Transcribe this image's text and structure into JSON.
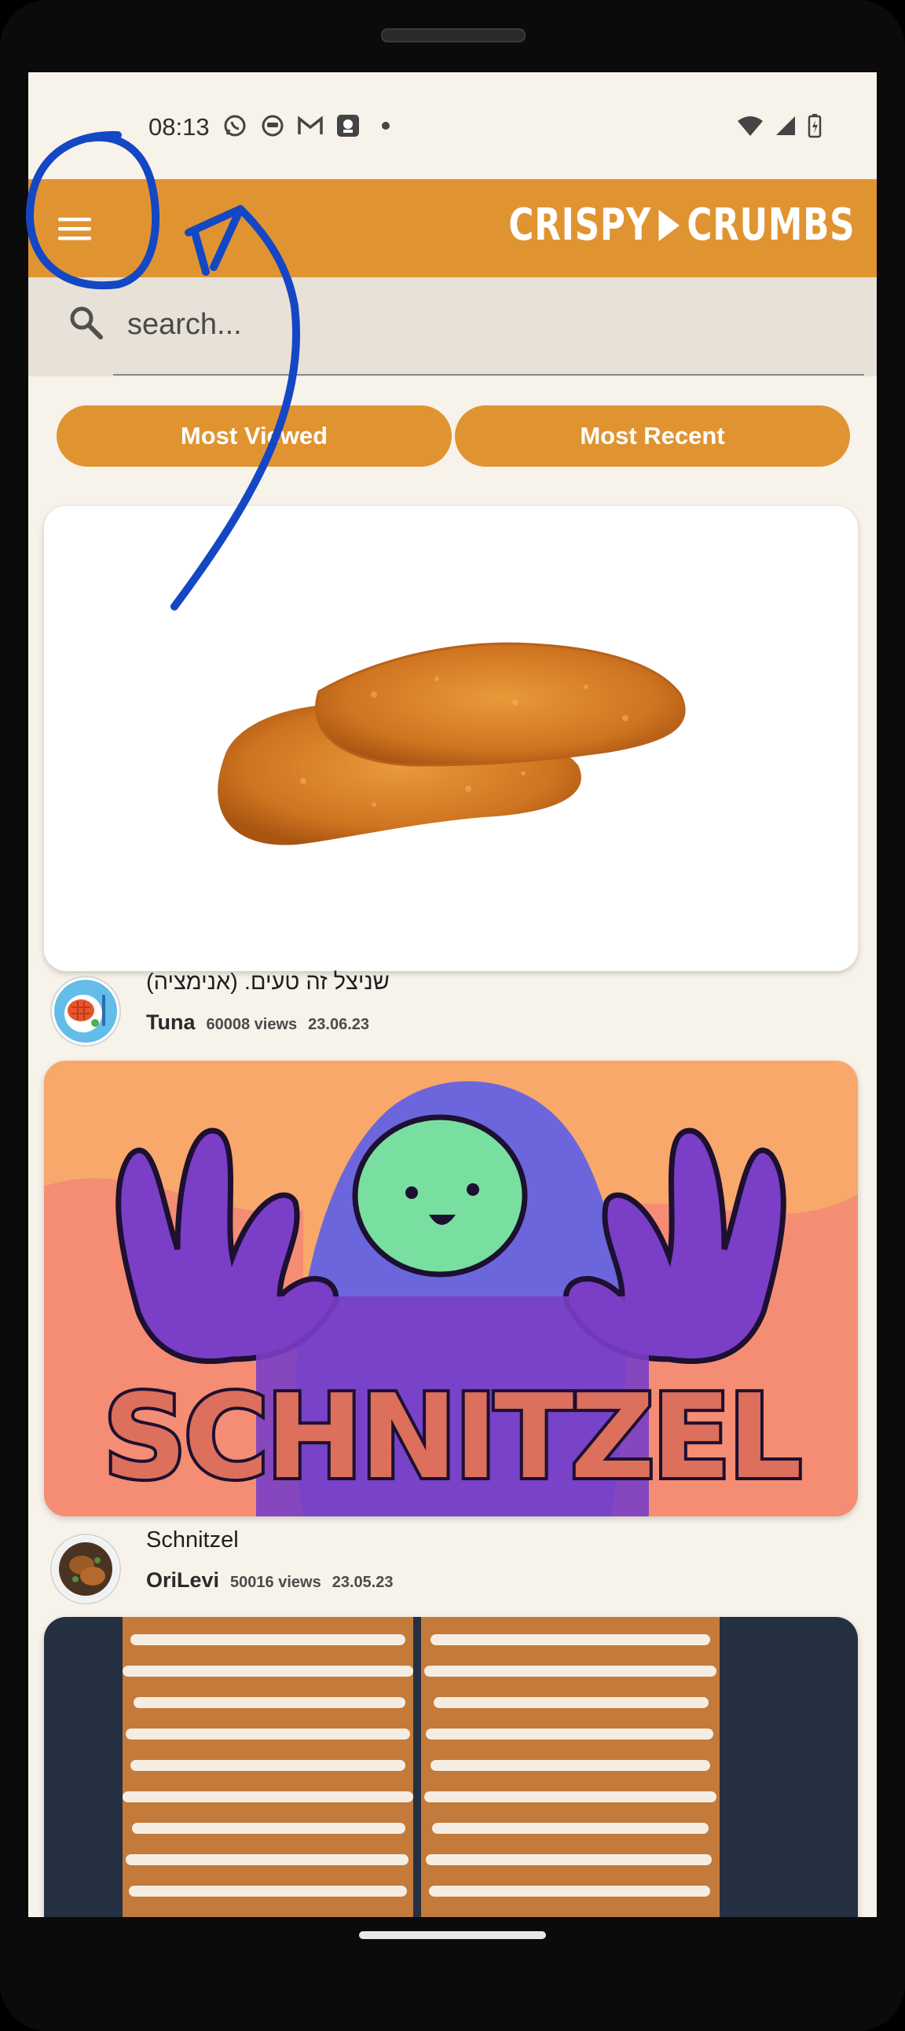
{
  "status_bar": {
    "time": "08:13",
    "left_icons": [
      "whatsapp-icon",
      "app-icon",
      "gmail-icon",
      "notification-icon"
    ]
  },
  "app_bar": {
    "logo_left": "CRISPY",
    "logo_right": "CRUMBS"
  },
  "search": {
    "placeholder": "search..."
  },
  "filters": {
    "most_viewed": "Most Viewed",
    "most_recent": "Most Recent"
  },
  "feed": [
    {
      "title": "שניצל זה טעים. (אנימציה)",
      "author": "Tuna",
      "views": "60008 views",
      "date": "23.06.23"
    },
    {
      "title": "Schnitzel",
      "author": "OriLevi",
      "views": "50016 views",
      "date": "23.05.23",
      "thumbnail_text": "SCHNITZEL"
    }
  ],
  "colors": {
    "accent": "#e09431",
    "background": "#f7f2ea",
    "search_bg": "#e7e1d7",
    "annotation": "#1447c4"
  }
}
